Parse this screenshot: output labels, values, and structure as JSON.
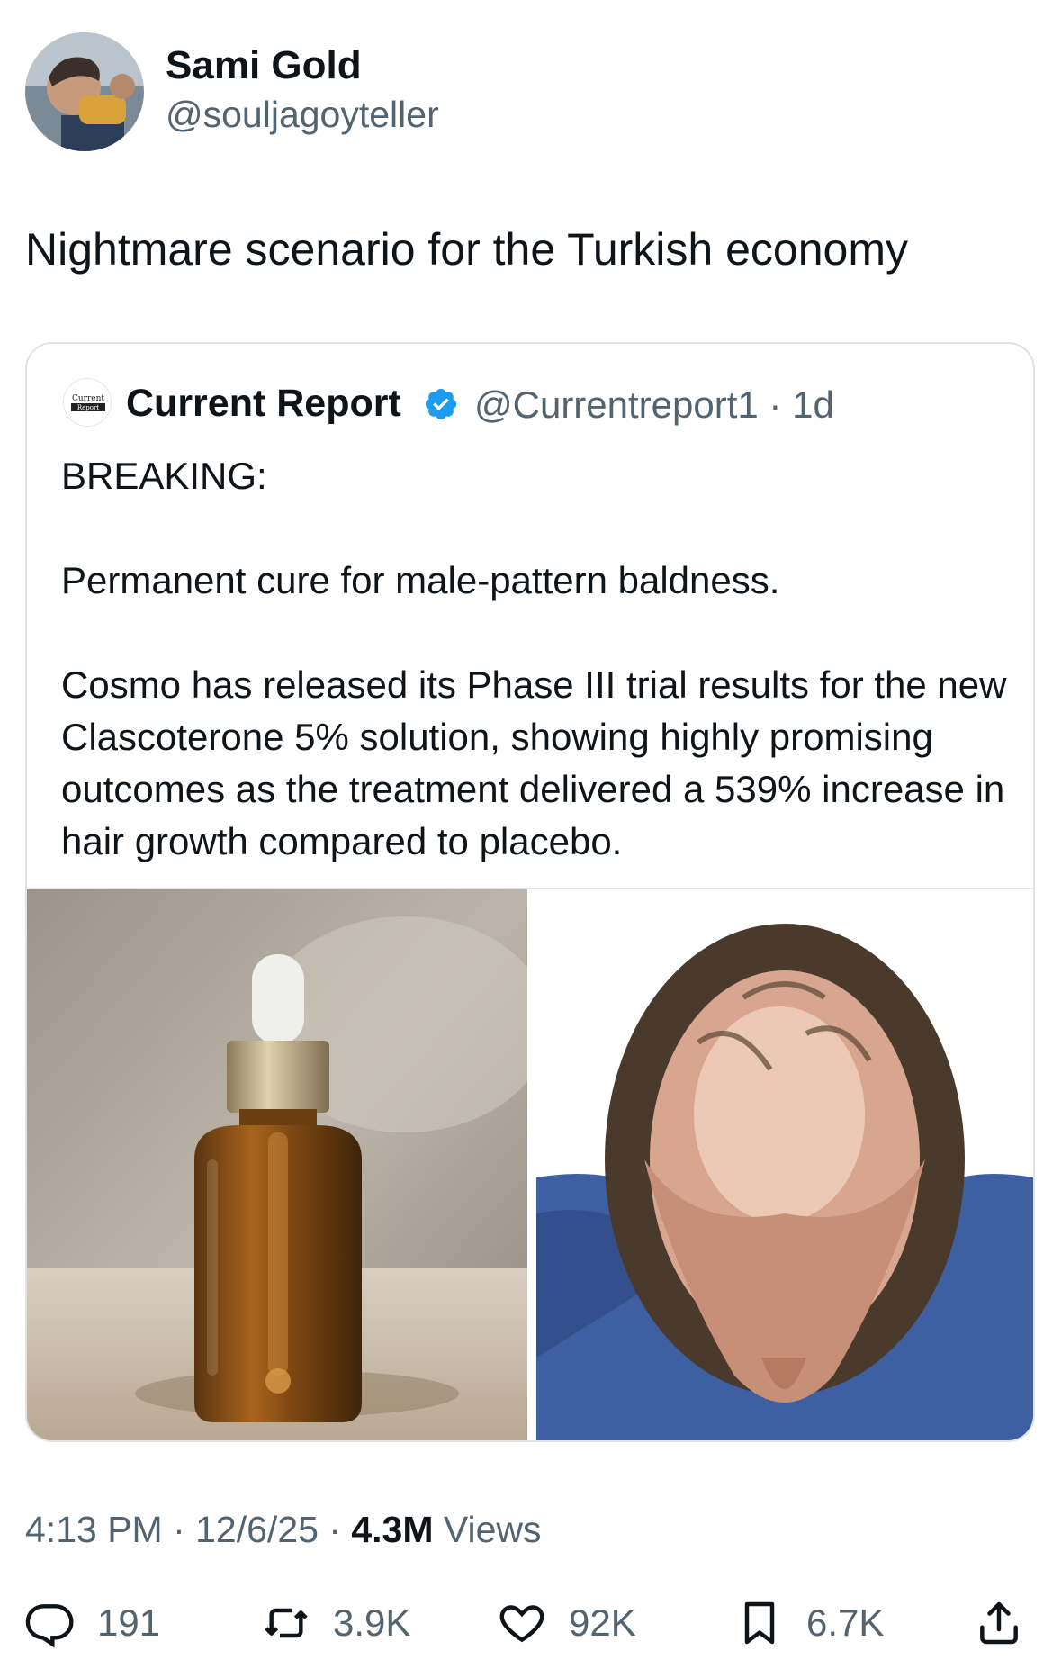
{
  "author": {
    "name": "Sami Gold",
    "handle": "@souljagoyteller",
    "avatar_icon": "avatar-photo"
  },
  "tweet": {
    "text": "Nightmare scenario for the Turkish economy"
  },
  "quoted": {
    "logo_text_top": "Current",
    "logo_text_bottom": "Report",
    "name": "Current Report",
    "verified_icon": "verified-badge-icon",
    "handle_time": "@Currentreport1 · 1d",
    "line1": "BREAKING:",
    "line2": "Permanent cure for male-pattern baldness.",
    "line3": "Cosmo has released its Phase III trial results for the new Clascoterone 5% solution, showing highly promising outcomes as the treatment delivered a 539% increase in hair growth compared to placebo.",
    "image_left_icon": "serum-bottle-photo",
    "image_right_icon": "balding-head-photo"
  },
  "meta": {
    "time_date": "4:13 PM · 12/6/25 · ",
    "views_count": "4.3M",
    "views_label": " Views"
  },
  "actions": {
    "replies": "191",
    "reposts": "3.9K",
    "likes": "92K",
    "bookmarks": "6.7K"
  },
  "colors": {
    "text": "#0f1419",
    "secondary": "#536471",
    "verified": "#1d9bf0",
    "border": "#dfe3e7"
  }
}
